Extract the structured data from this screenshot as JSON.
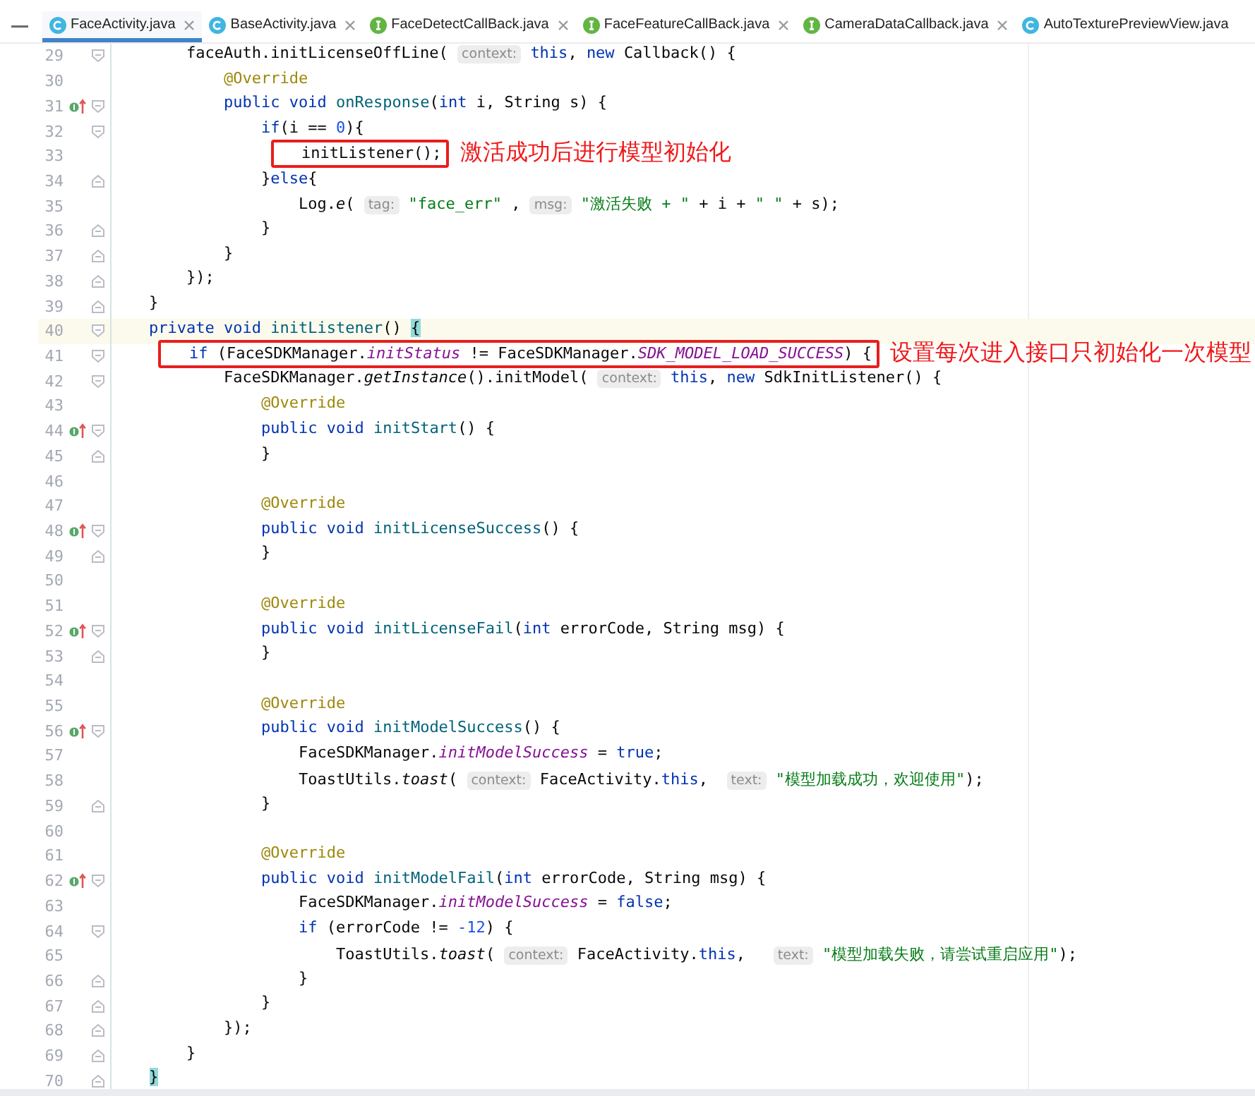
{
  "tabs": [
    {
      "label": "FaceActivity.java",
      "kind": "class",
      "selected": true,
      "closable": true
    },
    {
      "label": "BaseActivity.java",
      "kind": "class",
      "selected": false,
      "closable": true
    },
    {
      "label": "FaceDetectCallBack.java",
      "kind": "interface",
      "selected": false,
      "closable": true
    },
    {
      "label": "FaceFeatureCallBack.java",
      "kind": "interface",
      "selected": false,
      "closable": true
    },
    {
      "label": "CameraDataCallback.java",
      "kind": "interface",
      "selected": false,
      "closable": true
    },
    {
      "label": "AutoTexturePreviewView.java",
      "kind": "class",
      "selected": false,
      "closable": false
    }
  ],
  "lines": [
    {
      "number": "29",
      "override": false,
      "current": false,
      "fold_start": true,
      "fold_end": false,
      "segments": [
        {
          "kind": "plain",
          "text": "        faceAuth.initLicenseOffLine( "
        },
        {
          "kind": "hint",
          "text": "context:"
        },
        {
          "kind": "keyword",
          "text": " this"
        },
        {
          "kind": "plain",
          "text": ", "
        },
        {
          "kind": "keyword",
          "text": "new"
        },
        {
          "kind": "plain",
          "text": " Callback() {"
        }
      ]
    },
    {
      "number": "30",
      "override": false,
      "current": false,
      "fold_start": false,
      "fold_end": false,
      "segments": [
        {
          "kind": "annotation",
          "text": "            @Override"
        }
      ]
    },
    {
      "number": "31",
      "override": true,
      "current": false,
      "fold_start": true,
      "fold_end": false,
      "segments": [
        {
          "kind": "keyword",
          "text": "            public void"
        },
        {
          "kind": "decl",
          "text": " onResponse"
        },
        {
          "kind": "plain",
          "text": "("
        },
        {
          "kind": "keyword",
          "text": "int"
        },
        {
          "kind": "plain",
          "text": " i, String s) {"
        }
      ]
    },
    {
      "number": "32",
      "override": false,
      "current": false,
      "fold_start": true,
      "fold_end": false,
      "segments": [
        {
          "kind": "keyword",
          "text": "                if"
        },
        {
          "kind": "plain",
          "text": "(i == "
        },
        {
          "kind": "number",
          "text": "0"
        },
        {
          "kind": "plain",
          "text": "){"
        }
      ]
    },
    {
      "number": "33",
      "override": false,
      "current": false,
      "fold_start": false,
      "fold_end": false,
      "note": "激活成功后进行模型初始化",
      "segments": [
        {
          "kind": "plain",
          "text": "                    initListener();"
        }
      ]
    },
    {
      "number": "34",
      "override": false,
      "current": false,
      "fold_start": false,
      "fold_end": true,
      "segments": [
        {
          "kind": "plain",
          "text": "                }"
        },
        {
          "kind": "keyword",
          "text": "else"
        },
        {
          "kind": "plain",
          "text": "{"
        }
      ]
    },
    {
      "number": "35",
      "override": false,
      "current": false,
      "fold_start": false,
      "fold_end": false,
      "segments": [
        {
          "kind": "plain",
          "text": "                    Log."
        },
        {
          "kind": "italic",
          "text": "e"
        },
        {
          "kind": "plain",
          "text": "( "
        },
        {
          "kind": "hint",
          "text": "tag:"
        },
        {
          "kind": "string",
          "text": " \"face_err\""
        },
        {
          "kind": "plain",
          "text": " , "
        },
        {
          "kind": "hint",
          "text": "msg:"
        },
        {
          "kind": "string",
          "text": " \"激活失败 + \""
        },
        {
          "kind": "plain",
          "text": " + i + "
        },
        {
          "kind": "string",
          "text": "\" \""
        },
        {
          "kind": "plain",
          "text": " + s);"
        }
      ]
    },
    {
      "number": "36",
      "override": false,
      "current": false,
      "fold_start": false,
      "fold_end": true,
      "segments": [
        {
          "kind": "plain",
          "text": "                }"
        }
      ]
    },
    {
      "number": "37",
      "override": false,
      "current": false,
      "fold_start": false,
      "fold_end": true,
      "segments": [
        {
          "kind": "plain",
          "text": "            }"
        }
      ]
    },
    {
      "number": "38",
      "override": false,
      "current": false,
      "fold_start": false,
      "fold_end": true,
      "segments": [
        {
          "kind": "plain",
          "text": "        });"
        }
      ]
    },
    {
      "number": "39",
      "override": false,
      "current": false,
      "fold_start": false,
      "fold_end": true,
      "segments": [
        {
          "kind": "plain",
          "text": "    }"
        }
      ]
    },
    {
      "number": "40",
      "override": false,
      "current": true,
      "fold_start": true,
      "fold_end": false,
      "segments": [
        {
          "kind": "keyword",
          "text": "    private void"
        },
        {
          "kind": "decl",
          "text": " initListener"
        },
        {
          "kind": "plain",
          "text": "() "
        },
        {
          "kind": "match",
          "text": "{"
        }
      ]
    },
    {
      "number": "41",
      "override": false,
      "current": false,
      "fold_start": true,
      "fold_end": false,
      "note": "设置每次进入接口只初始化一次模型",
      "segments": [
        {
          "kind": "keyword",
          "text": "        if"
        },
        {
          "kind": "plain",
          "text": " (FaceSDKManager."
        },
        {
          "kind": "field",
          "text": "initStatus"
        },
        {
          "kind": "plain",
          "text": " != FaceSDKManager."
        },
        {
          "kind": "field",
          "text": "SDK_MODEL_LOAD_SUCCESS"
        },
        {
          "kind": "plain",
          "text": ") {"
        }
      ]
    },
    {
      "number": "42",
      "override": false,
      "current": false,
      "fold_start": true,
      "fold_end": false,
      "segments": [
        {
          "kind": "plain",
          "text": "            FaceSDKManager."
        },
        {
          "kind": "italic",
          "text": "getInstance"
        },
        {
          "kind": "plain",
          "text": "().initModel( "
        },
        {
          "kind": "hint",
          "text": "context:"
        },
        {
          "kind": "keyword",
          "text": " this"
        },
        {
          "kind": "plain",
          "text": ", "
        },
        {
          "kind": "keyword",
          "text": "new"
        },
        {
          "kind": "plain",
          "text": " SdkInitListener() {"
        }
      ]
    },
    {
      "number": "43",
      "override": false,
      "current": false,
      "fold_start": false,
      "fold_end": false,
      "segments": [
        {
          "kind": "annotation",
          "text": "                @Override"
        }
      ]
    },
    {
      "number": "44",
      "override": true,
      "current": false,
      "fold_start": true,
      "fold_end": false,
      "segments": [
        {
          "kind": "keyword",
          "text": "                public void"
        },
        {
          "kind": "decl",
          "text": " initStart"
        },
        {
          "kind": "plain",
          "text": "() {"
        }
      ]
    },
    {
      "number": "45",
      "override": false,
      "current": false,
      "fold_start": false,
      "fold_end": true,
      "segments": [
        {
          "kind": "plain",
          "text": "                }"
        }
      ]
    },
    {
      "number": "46",
      "override": false,
      "current": false,
      "fold_start": false,
      "fold_end": false
    },
    {
      "number": "47",
      "override": false,
      "current": false,
      "fold_start": false,
      "fold_end": false,
      "segments": [
        {
          "kind": "annotation",
          "text": "                @Override"
        }
      ]
    },
    {
      "number": "48",
      "override": true,
      "current": false,
      "fold_start": true,
      "fold_end": false,
      "segments": [
        {
          "kind": "keyword",
          "text": "                public void"
        },
        {
          "kind": "decl",
          "text": " initLicenseSuccess"
        },
        {
          "kind": "plain",
          "text": "() {"
        }
      ]
    },
    {
      "number": "49",
      "override": false,
      "current": false,
      "fold_start": false,
      "fold_end": true,
      "segments": [
        {
          "kind": "plain",
          "text": "                }"
        }
      ]
    },
    {
      "number": "50",
      "override": false,
      "current": false,
      "fold_start": false,
      "fold_end": false
    },
    {
      "number": "51",
      "override": false,
      "current": false,
      "fold_start": false,
      "fold_end": false,
      "segments": [
        {
          "kind": "annotation",
          "text": "                @Override"
        }
      ]
    },
    {
      "number": "52",
      "override": true,
      "current": false,
      "fold_start": true,
      "fold_end": false,
      "segments": [
        {
          "kind": "keyword",
          "text": "                public void"
        },
        {
          "kind": "decl",
          "text": " initLicenseFail"
        },
        {
          "kind": "plain",
          "text": "("
        },
        {
          "kind": "keyword",
          "text": "int"
        },
        {
          "kind": "plain",
          "text": " errorCode, String msg) {"
        }
      ]
    },
    {
      "number": "53",
      "override": false,
      "current": false,
      "fold_start": false,
      "fold_end": true,
      "segments": [
        {
          "kind": "plain",
          "text": "                }"
        }
      ]
    },
    {
      "number": "54",
      "override": false,
      "current": false,
      "fold_start": false,
      "fold_end": false
    },
    {
      "number": "55",
      "override": false,
      "current": false,
      "fold_start": false,
      "fold_end": false,
      "segments": [
        {
          "kind": "annotation",
          "text": "                @Override"
        }
      ]
    },
    {
      "number": "56",
      "override": true,
      "current": false,
      "fold_start": true,
      "fold_end": false,
      "segments": [
        {
          "kind": "keyword",
          "text": "                public void"
        },
        {
          "kind": "decl",
          "text": " initModelSuccess"
        },
        {
          "kind": "plain",
          "text": "() {"
        }
      ]
    },
    {
      "number": "57",
      "override": false,
      "current": false,
      "fold_start": false,
      "fold_end": false,
      "segments": [
        {
          "kind": "plain",
          "text": "                    FaceSDKManager."
        },
        {
          "kind": "field",
          "text": "initModelSuccess"
        },
        {
          "kind": "plain",
          "text": " = "
        },
        {
          "kind": "keyword",
          "text": "true"
        },
        {
          "kind": "plain",
          "text": ";"
        }
      ]
    },
    {
      "number": "58",
      "override": false,
      "current": false,
      "fold_start": false,
      "fold_end": false,
      "segments": [
        {
          "kind": "plain",
          "text": "                    ToastUtils."
        },
        {
          "kind": "italic",
          "text": "toast"
        },
        {
          "kind": "plain",
          "text": "( "
        },
        {
          "kind": "hint",
          "text": "context:"
        },
        {
          "kind": "plain",
          "text": " FaceActivity."
        },
        {
          "kind": "keyword",
          "text": "this"
        },
        {
          "kind": "plain",
          "text": ",  "
        },
        {
          "kind": "hint",
          "text": "text:"
        },
        {
          "kind": "string",
          "text": " \"模型加载成功，欢迎使用\""
        },
        {
          "kind": "plain",
          "text": ");"
        }
      ]
    },
    {
      "number": "59",
      "override": false,
      "current": false,
      "fold_start": false,
      "fold_end": true,
      "segments": [
        {
          "kind": "plain",
          "text": "                }"
        }
      ]
    },
    {
      "number": "60",
      "override": false,
      "current": false,
      "fold_start": false,
      "fold_end": false
    },
    {
      "number": "61",
      "override": false,
      "current": false,
      "fold_start": false,
      "fold_end": false,
      "segments": [
        {
          "kind": "annotation",
          "text": "                @Override"
        }
      ]
    },
    {
      "number": "62",
      "override": true,
      "current": false,
      "fold_start": true,
      "fold_end": false,
      "segments": [
        {
          "kind": "keyword",
          "text": "                public void"
        },
        {
          "kind": "decl",
          "text": " initModelFail"
        },
        {
          "kind": "plain",
          "text": "("
        },
        {
          "kind": "keyword",
          "text": "int"
        },
        {
          "kind": "plain",
          "text": " errorCode, String msg) {"
        }
      ]
    },
    {
      "number": "63",
      "override": false,
      "current": false,
      "fold_start": false,
      "fold_end": false,
      "segments": [
        {
          "kind": "plain",
          "text": "                    FaceSDKManager."
        },
        {
          "kind": "field",
          "text": "initModelSuccess"
        },
        {
          "kind": "plain",
          "text": " = "
        },
        {
          "kind": "keyword",
          "text": "false"
        },
        {
          "kind": "plain",
          "text": ";"
        }
      ]
    },
    {
      "number": "64",
      "override": false,
      "current": false,
      "fold_start": true,
      "fold_end": false,
      "segments": [
        {
          "kind": "keyword",
          "text": "                    if"
        },
        {
          "kind": "plain",
          "text": " (errorCode != "
        },
        {
          "kind": "number",
          "text": "-12"
        },
        {
          "kind": "plain",
          "text": ") {"
        }
      ]
    },
    {
      "number": "65",
      "override": false,
      "current": false,
      "fold_start": false,
      "fold_end": false,
      "segments": [
        {
          "kind": "plain",
          "text": "                        ToastUtils."
        },
        {
          "kind": "italic",
          "text": "toast"
        },
        {
          "kind": "plain",
          "text": "( "
        },
        {
          "kind": "hint",
          "text": "context:"
        },
        {
          "kind": "plain",
          "text": " FaceActivity."
        },
        {
          "kind": "keyword",
          "text": "this"
        },
        {
          "kind": "plain",
          "text": ",   "
        },
        {
          "kind": "hint",
          "text": "text:"
        },
        {
          "kind": "string",
          "text": " \"模型加载失败，请尝试重启应用\""
        },
        {
          "kind": "plain",
          "text": ");"
        }
      ]
    },
    {
      "number": "66",
      "override": false,
      "current": false,
      "fold_start": false,
      "fold_end": true,
      "segments": [
        {
          "kind": "plain",
          "text": "                    }"
        }
      ]
    },
    {
      "number": "67",
      "override": false,
      "current": false,
      "fold_start": false,
      "fold_end": true,
      "segments": [
        {
          "kind": "plain",
          "text": "                }"
        }
      ]
    },
    {
      "number": "68",
      "override": false,
      "current": false,
      "fold_start": false,
      "fold_end": true,
      "segments": [
        {
          "kind": "plain",
          "text": "            });"
        }
      ]
    },
    {
      "number": "69",
      "override": false,
      "current": false,
      "fold_start": false,
      "fold_end": true,
      "segments": [
        {
          "kind": "plain",
          "text": "        }"
        }
      ]
    },
    {
      "number": "70",
      "override": false,
      "current": false,
      "fold_start": false,
      "fold_end": true,
      "segments": [
        {
          "kind": "match",
          "text": "    }"
        }
      ]
    }
  ]
}
